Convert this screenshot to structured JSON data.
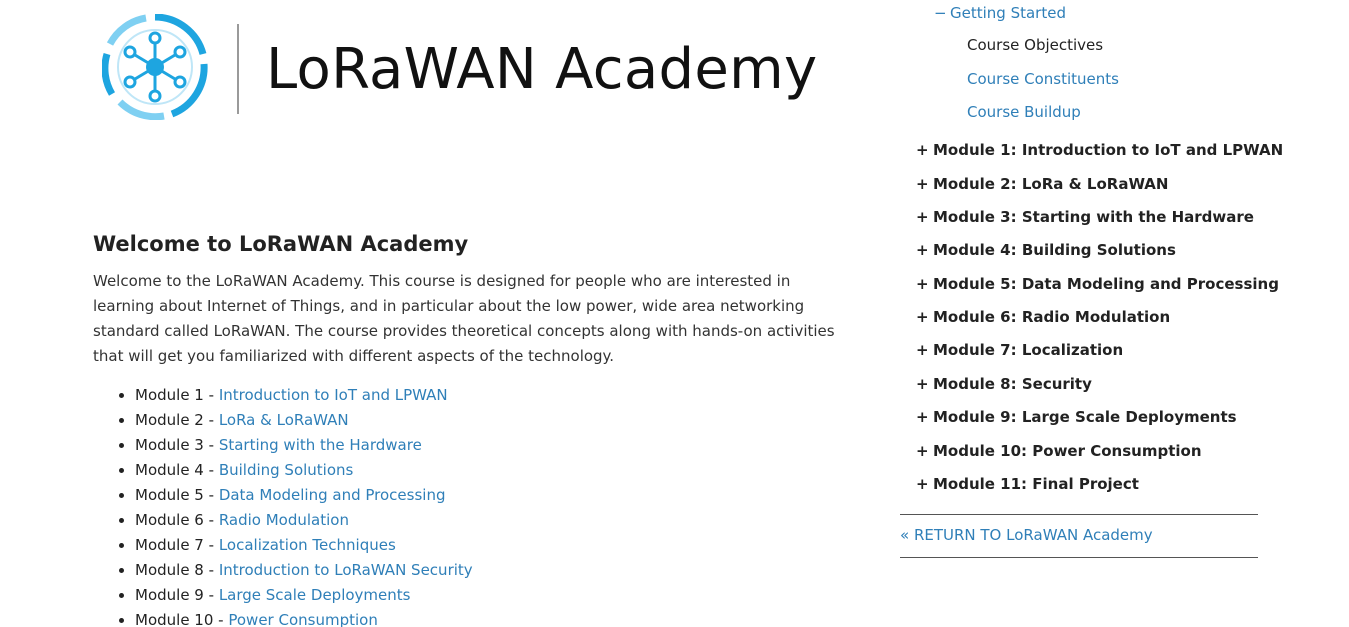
{
  "logo": {
    "text": "LoRaWAN Academy",
    "icon": "network-hub-icon",
    "colors": {
      "primary": "#1ea5e0",
      "light": "#7fd0f2"
    }
  },
  "main": {
    "title": "Welcome to LoRaWAN Academy",
    "intro": "Welcome to the LoRaWAN Academy. This course is designed for people who are interested in learning about Internet of Things, and in particular about the low power, wide area networking standard called LoRaWAN. The course provides theoretical concepts along with hands-on activities that will get you familiarized with different aspects of the technology.",
    "modules": [
      {
        "prefix": "Module 1 - ",
        "link": "Introduction to IoT and LPWAN"
      },
      {
        "prefix": "Module 2 - ",
        "link": "LoRa & LoRaWAN"
      },
      {
        "prefix": "Module 3 - ",
        "link": "Starting with the Hardware"
      },
      {
        "prefix": "Module 4 - ",
        "link": "Building Solutions"
      },
      {
        "prefix": "Module 5 - ",
        "link": "Data Modeling and Processing"
      },
      {
        "prefix": "Module 6 - ",
        "link": "Radio Modulation"
      },
      {
        "prefix": "Module 7 - ",
        "link": "Localization Techniques"
      },
      {
        "prefix": "Module 8 - ",
        "link": "Introduction to LoRaWAN Security"
      },
      {
        "prefix": "Module 9 - ",
        "link": "Large Scale Deployments"
      },
      {
        "prefix": "Module 10 - ",
        "link": "Power Consumption"
      }
    ]
  },
  "sidebar": {
    "getting_started": {
      "toggle": "−",
      "label": "Getting Started"
    },
    "sub_items": [
      {
        "label": "Course Objectives",
        "current": true
      },
      {
        "label": "Course Constituents",
        "current": false
      },
      {
        "label": "Course Buildup",
        "current": false
      }
    ],
    "modules": [
      {
        "toggle": "+",
        "label": "Module 1: Introduction to IoT and LPWAN"
      },
      {
        "toggle": "+",
        "label": "Module 2: LoRa & LoRaWAN"
      },
      {
        "toggle": "+",
        "label": "Module 3: Starting with the Hardware"
      },
      {
        "toggle": "+",
        "label": "Module 4: Building Solutions"
      },
      {
        "toggle": "+",
        "label": "Module 5: Data Modeling and Processing"
      },
      {
        "toggle": "+",
        "label": "Module 6: Radio Modulation"
      },
      {
        "toggle": "+",
        "label": "Module 7: Localization"
      },
      {
        "toggle": "+",
        "label": "Module 8: Security"
      },
      {
        "toggle": "+",
        "label": "Module 9: Large Scale Deployments"
      },
      {
        "toggle": "+",
        "label": "Module 10: Power Consumption"
      },
      {
        "toggle": "+",
        "label": "Module 11: Final Project"
      }
    ],
    "return_link": "« RETURN TO LoRaWAN Academy"
  }
}
